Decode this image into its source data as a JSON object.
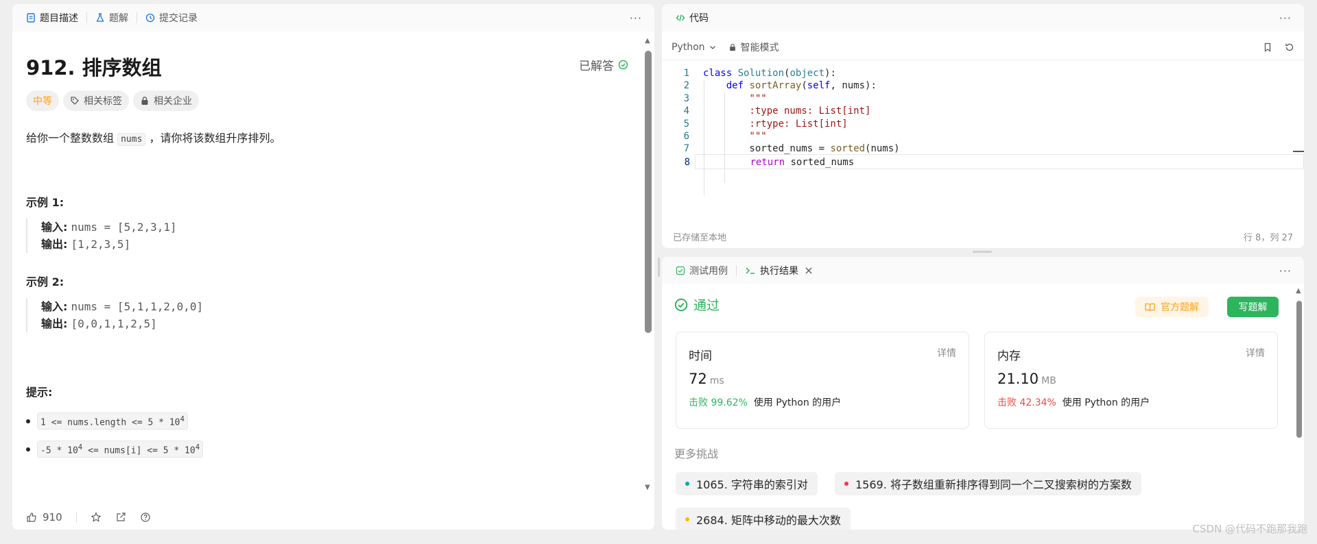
{
  "left": {
    "tabs": [
      {
        "label": "题目描述",
        "icon": "document-icon",
        "color": "#1a73e8"
      },
      {
        "label": "题解",
        "icon": "flask-icon",
        "color": "#1a73e8"
      },
      {
        "label": "提交记录",
        "icon": "history-icon",
        "color": "#1a73e8"
      }
    ],
    "title": "912. 排序数组",
    "solved_label": "已解答",
    "tags": {
      "difficulty": "中等",
      "related_tags": "相关标签",
      "related_companies": "相关企业"
    },
    "description": {
      "before": "给你一个整数数组",
      "code": "nums",
      "after": "，请你将该数组升序排列。"
    },
    "examples": [
      {
        "heading": "示例 1:",
        "input_label": "输入:",
        "input_value": "nums = [5,2,3,1]",
        "output_label": "输出:",
        "output_value": "[1,2,3,5]"
      },
      {
        "heading": "示例 2:",
        "input_label": "输入:",
        "input_value": "nums = [5,1,1,2,0,0]",
        "output_label": "输出:",
        "output_value": "[0,0,1,1,2,5]"
      }
    ],
    "hints_heading": "提示:",
    "hints": [
      {
        "before": "1 <= nums.length <= 5 * 10",
        "sup": "4",
        "after": ""
      },
      {
        "before": "-5 * 10",
        "sup": "4",
        "after": " <= nums[i] <= 5 * 10",
        "sup2": "4"
      }
    ],
    "likes": "910"
  },
  "editor": {
    "tab": "代码",
    "language": "Python",
    "mode": "智能模式",
    "lines": [
      {
        "n": "1",
        "tokens": [
          [
            "kw",
            "class"
          ],
          [
            "",
            ""
          ],
          [
            "cls",
            " Solution"
          ],
          [
            "",
            "("
          ],
          [
            "cls",
            "object"
          ],
          [
            "",
            "):"
          ]
        ]
      },
      {
        "n": "2",
        "tokens": [
          [
            "",
            "    "
          ],
          [
            "kw",
            "def"
          ],
          [
            "fn",
            " sortArray"
          ],
          [
            "",
            "("
          ],
          [
            "kw",
            "self"
          ],
          [
            "",
            ", nums):"
          ]
        ]
      },
      {
        "n": "3",
        "tokens": [
          [
            "str",
            "        \"\"\""
          ]
        ]
      },
      {
        "n": "4",
        "tokens": [
          [
            "str",
            "        :type nums: List[int]"
          ]
        ]
      },
      {
        "n": "5",
        "tokens": [
          [
            "str",
            "        :rtype: List[int]"
          ]
        ]
      },
      {
        "n": "6",
        "tokens": [
          [
            "str",
            "        \"\"\""
          ]
        ]
      },
      {
        "n": "7",
        "tokens": [
          [
            "",
            "        sorted_nums = "
          ],
          [
            "fn",
            "sorted"
          ],
          [
            "",
            "(nums)"
          ]
        ]
      },
      {
        "n": "8",
        "tokens": [
          [
            "",
            "        "
          ],
          [
            "kw2",
            "return"
          ],
          [
            "",
            " sorted_nums"
          ]
        ]
      }
    ],
    "saved": "已存储至本地",
    "cursor": "行 8，列 27"
  },
  "result": {
    "tabs": {
      "testcase": "测试用例",
      "output": "执行结果"
    },
    "status": "通过",
    "official_solution": "官方题解",
    "write_solution": "写题解",
    "time": {
      "label": "时间",
      "detail": "详情",
      "value": "72",
      "unit": "ms",
      "beat": "击败 99.62%",
      "suffix": "使用 Python 的用户",
      "beat_color": "#2db55d"
    },
    "memory": {
      "label": "内存",
      "detail": "详情",
      "value": "21.10",
      "unit": "MB",
      "beat": "击败 42.34%",
      "suffix": "使用 Python 的用户",
      "beat_color": "#ef4743"
    },
    "more": "更多挑战",
    "challenges": [
      {
        "label": "1065. 字符串的索引对",
        "color": "#00af9b"
      },
      {
        "label": "1569. 将子数组重新排序得到同一个二叉搜索树的方案数",
        "color": "#ff2d55"
      },
      {
        "label": "2684. 矩阵中移动的最大次数",
        "color": "#ffb800"
      }
    ]
  },
  "watermark": "CSDN @代码不跑那我跑"
}
